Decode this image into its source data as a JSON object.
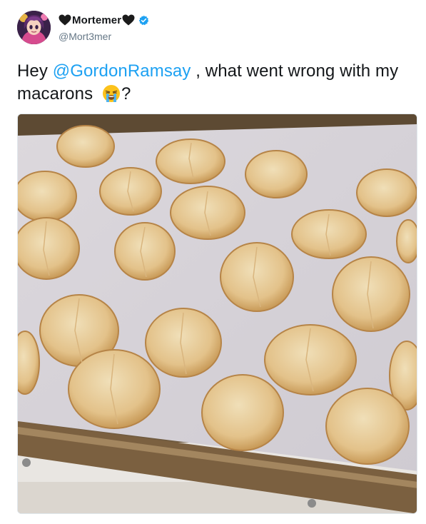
{
  "tweet": {
    "display_name": "Mortemer",
    "handle": "@Mort3mer",
    "text_before": "Hey ",
    "mention": "@GordonRamsay",
    "text_after": " , what went wrong with my macarons ",
    "text_end": "?",
    "emoji": "loudly-crying-face",
    "verified": true,
    "icons": {
      "left_heart": "black-heart-icon",
      "right_heart": "black-heart-icon",
      "verified": "verified-badge-icon"
    },
    "colors": {
      "link": "#1da1f2",
      "verified": "#1da1f2",
      "text": "#14171a",
      "handle": "#657786"
    },
    "photo": {
      "subject": "tray of cracked macarons on parchment paper",
      "macaron_count": 22
    }
  }
}
